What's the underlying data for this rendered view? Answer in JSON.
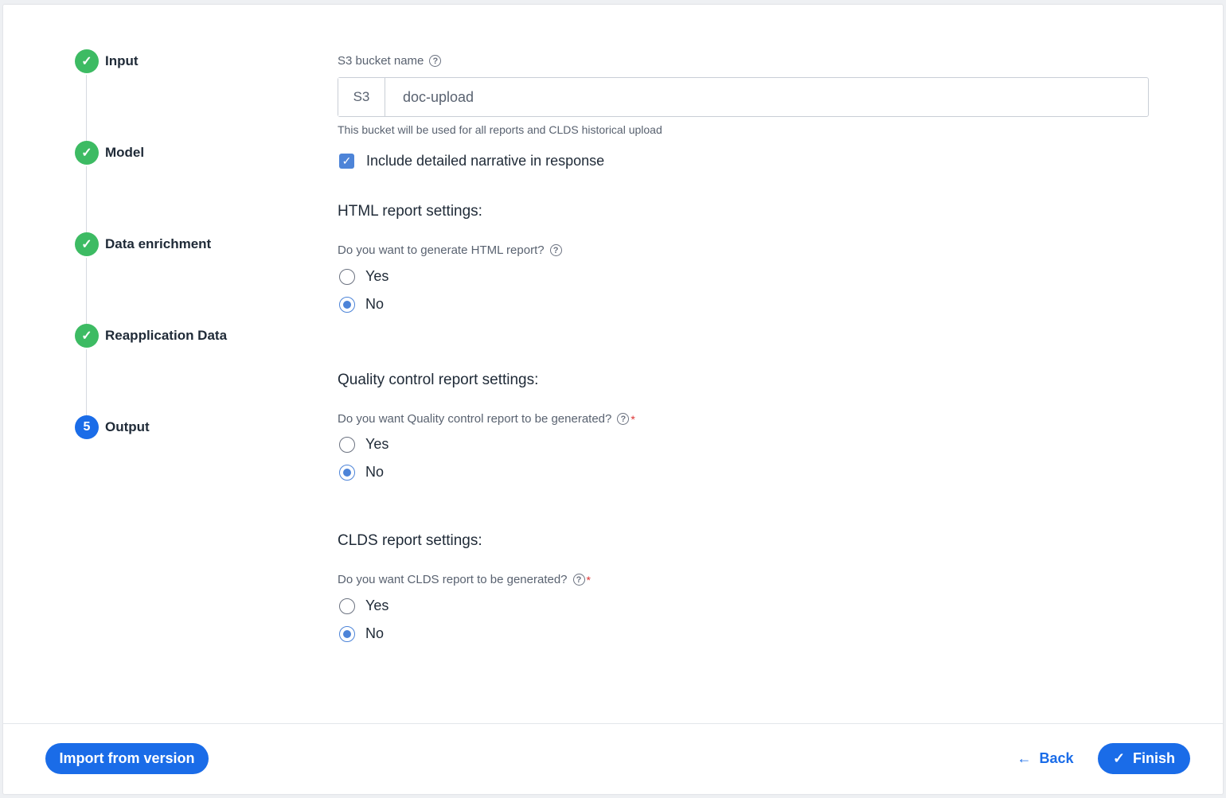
{
  "stepper": {
    "steps": [
      {
        "label": "Input",
        "status": "done"
      },
      {
        "label": "Model",
        "status": "done"
      },
      {
        "label": "Data enrichment",
        "status": "done"
      },
      {
        "label": "Reapplication Data",
        "status": "done"
      },
      {
        "label": "Output",
        "status": "active",
        "number": "5"
      }
    ]
  },
  "s3": {
    "label": "S3 bucket name",
    "prefix": "S3",
    "value": "doc-upload",
    "hint": "This bucket will be used for all reports and CLDS historical upload"
  },
  "narrative": {
    "label": "Include detailed narrative in response",
    "checked": true
  },
  "html_report": {
    "title": "HTML report settings:",
    "question": "Do you want to generate HTML report?",
    "options": [
      "Yes",
      "No"
    ],
    "selected": "No"
  },
  "qc_report": {
    "title": "Quality control report settings:",
    "question": "Do you want Quality control report to be generated?",
    "required_mark": "*",
    "options": [
      "Yes",
      "No"
    ],
    "selected": "No"
  },
  "clds_report": {
    "title": "CLDS report settings:",
    "question": "Do you want CLDS report to be generated?",
    "required_mark": "*",
    "options": [
      "Yes",
      "No"
    ],
    "selected": "No"
  },
  "footer": {
    "import_label": "Import from version",
    "back_label": "Back",
    "finish_label": "Finish"
  },
  "icons": {
    "check": "✓",
    "help": "?",
    "arrow_left": "←"
  },
  "colors": {
    "primary": "#1a6ce8",
    "success": "#3dbb63",
    "checkbox": "#4d84d8",
    "required": "#dd3333"
  }
}
